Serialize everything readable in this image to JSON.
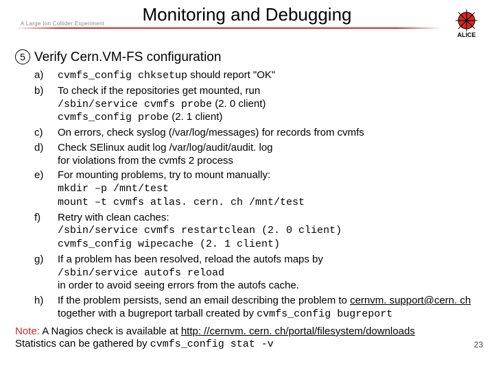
{
  "header": {
    "subtitle": "A Large Ion Collider Experiment",
    "title": "Monitoring and Debugging",
    "logo_label": "ALICE"
  },
  "section": {
    "number": "5",
    "heading": "Verify Cern.VM-FS configuration"
  },
  "items": {
    "a": {
      "label": "a)",
      "cmd": "cvmfs_config chksetup",
      "text": " should report \"OK\""
    },
    "b": {
      "label": "b)",
      "line1": "To check if the repositories get mounted, run",
      "cmd1": "/sbin/service cvmfs probe",
      "suffix1": " (2. 0 client)",
      "cmd2": "cvmfs_config probe",
      "suffix2": " (2. 1 client)"
    },
    "c": {
      "label": "c)",
      "text": "On errors, check syslog (/var/log/messages) for records from cvmfs"
    },
    "d": {
      "label": "d)",
      "line1": "Check SElinux audit log /var/log/audit/audit. log",
      "line2": "for violations from the cvmfs 2 process"
    },
    "e": {
      "label": "e)",
      "line1": "For mounting problems, try to mount manually:",
      "cmd1": "mkdir –p /mnt/test",
      "cmd2": "mount –t cvmfs atlas. cern. ch /mnt/test"
    },
    "f": {
      "label": "f)",
      "line1": "Retry with clean caches:",
      "cmd1": "/sbin/service cvmfs restartclean (2. 0 client)",
      "cmd2": "cvmfs_config wipecache (2. 1 client)"
    },
    "g": {
      "label": "g)",
      "line1": "If a problem has been resolved, reload the autofs maps by",
      "cmd1": "/sbin/service autofs reload",
      "line2": "in order to avoid seeing errors from the autofs cache."
    },
    "h": {
      "label": "h)",
      "pre": "If the problem persists, send an email describing the problem to ",
      "email": "cernvm. support@cern. ch",
      "mid": " together with a bugreport tarball created by ",
      "cmd": "cvmfs_config bugreport"
    }
  },
  "note": {
    "label": "Note:",
    "text1": " A Nagios check is available at ",
    "link": "http: //cernvm. cern. ch/portal/filesystem/downloads",
    "text2": "Statistics can be gathered by ",
    "cmd": "cvmfs_config stat -v"
  },
  "page_number": "23"
}
